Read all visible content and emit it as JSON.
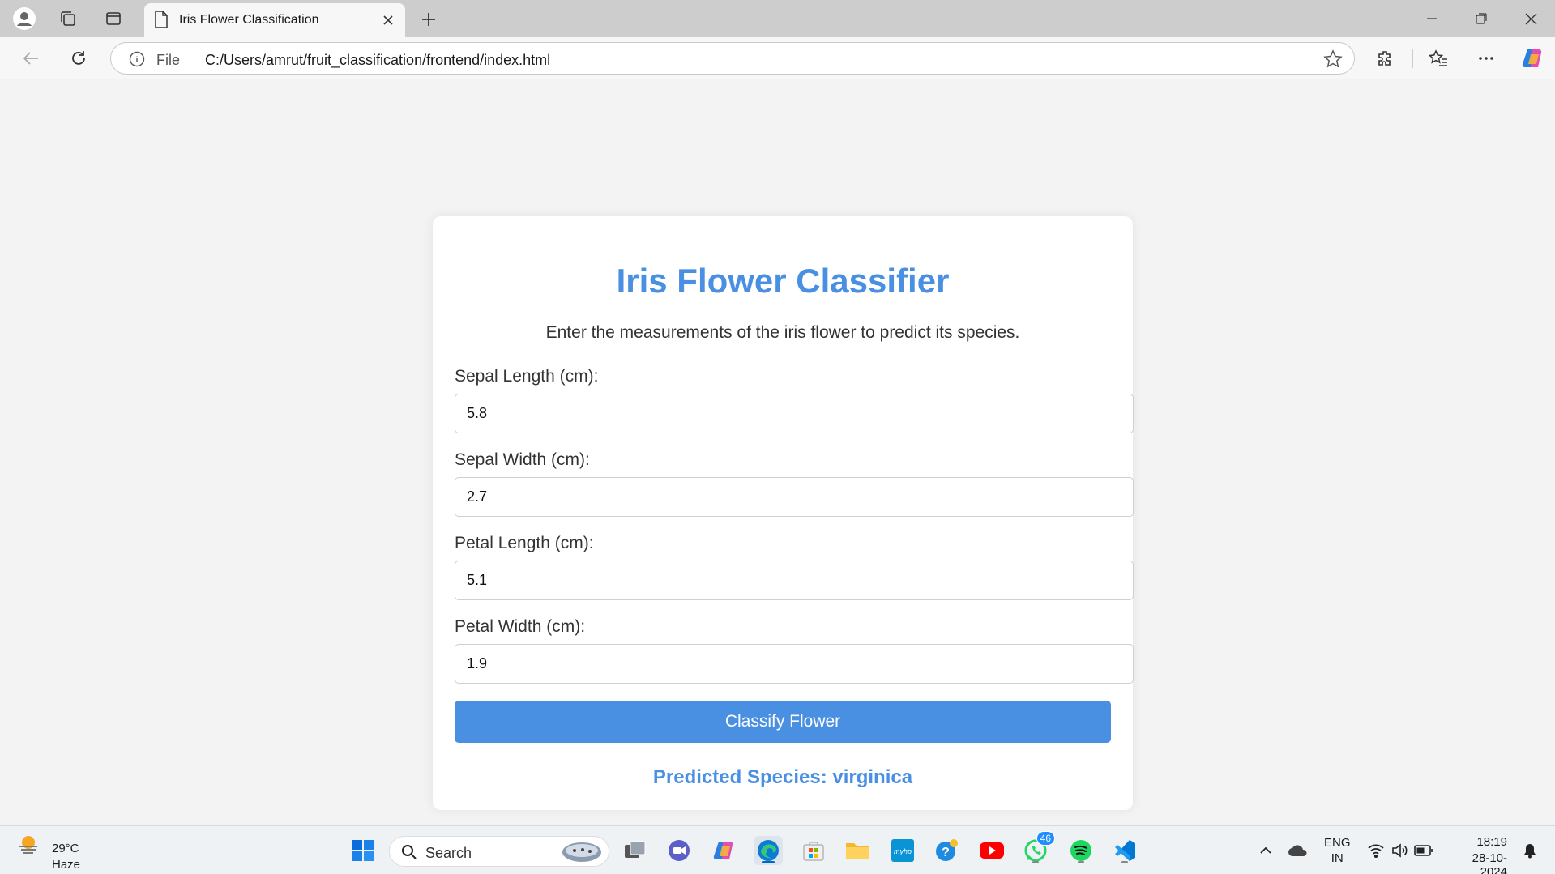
{
  "browser": {
    "tab_title": "Iris Flower Classification",
    "address_prefix": "File",
    "url": "C:/Users/amrut/fruit_classification/frontend/index.html"
  },
  "page": {
    "title": "Iris Flower Classifier",
    "subtitle": "Enter the measurements of the iris flower to predict its species.",
    "fields": [
      {
        "label": "Sepal Length (cm):",
        "value": "5.8"
      },
      {
        "label": "Sepal Width (cm):",
        "value": "2.7"
      },
      {
        "label": "Petal Length (cm):",
        "value": "5.1"
      },
      {
        "label": "Petal Width (cm):",
        "value": "1.9"
      }
    ],
    "button_label": "Classify Flower",
    "result": "Predicted Species: virginica",
    "accent_color": "#4a90e2"
  },
  "taskbar": {
    "weather_temp": "29°C",
    "weather_condition": "Haze",
    "search_placeholder": "Search",
    "whatsapp_badge": "46",
    "language_line1": "ENG",
    "language_line2": "IN",
    "time": "18:19",
    "date": "28-10-2024"
  }
}
